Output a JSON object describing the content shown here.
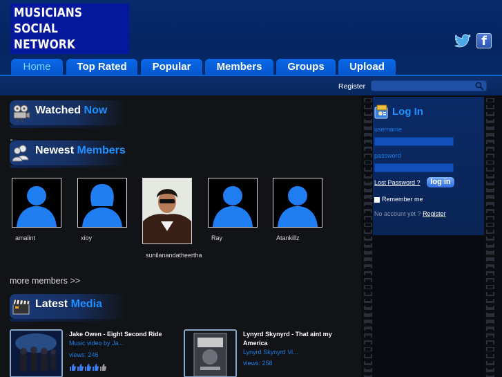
{
  "logo": {
    "lines": [
      "MUSICIANS",
      "SOCIAL",
      "NETWORK"
    ]
  },
  "header": {
    "social": {
      "twitter_icon": "twitter-bird-icon",
      "facebook_icon": "facebook-f-icon",
      "facebook_glyph": "f"
    },
    "tabs": [
      {
        "label": "Home",
        "active": true
      },
      {
        "label": "Top Rated",
        "active": false
      },
      {
        "label": "Popular",
        "active": false
      },
      {
        "label": "Members",
        "active": false
      },
      {
        "label": "Groups",
        "active": false
      },
      {
        "label": "Upload",
        "active": false
      }
    ]
  },
  "searchbar": {
    "register_label": "Register",
    "search_placeholder": "",
    "search_icon": "magnifier-icon"
  },
  "main": {
    "watched_now": {
      "title": "Watched",
      "highlight": "Now",
      "icon": "projector-icon"
    },
    "newest_members": {
      "title": "Newest",
      "highlight": "Members",
      "icon": "users-icon",
      "members": [
        {
          "name": "amalint",
          "avatar": "default-male"
        },
        {
          "name": "xioy",
          "avatar": "default-female"
        },
        {
          "name": "sunilanandatheertha",
          "avatar": "photo"
        },
        {
          "name": "Ray",
          "avatar": "default-male"
        },
        {
          "name": "Atankillz",
          "avatar": "default-male"
        }
      ],
      "more_link": "more members >>"
    },
    "latest_media": {
      "title": "Latest",
      "highlight": "Media",
      "icon": "clapperboard-icon",
      "items": [
        {
          "title": "Jake Owen - Eight Second Ride",
          "description": "Music video by Ja...",
          "views": "views: 246",
          "rating": 4
        },
        {
          "title": "Lynyrd Skynyrd - That aint my America",
          "description": "Lynyrd Skynyrd Vi...",
          "views": "views: 258",
          "rating": 0
        }
      ]
    }
  },
  "login": {
    "title": "Log In",
    "icon": "login-badge-icon",
    "username_label": "username",
    "password_label": "password",
    "lost_password": "Lost Password ?",
    "login_button": "log in",
    "remember_me": "Remember me",
    "no_account_text": "No account yet ?",
    "register_link": "Register"
  },
  "colors": {
    "header_bg": "#062a6b",
    "tab_bg": "#0a68e6",
    "accent": "#1e90ff",
    "logo_bg": "#05179d"
  }
}
